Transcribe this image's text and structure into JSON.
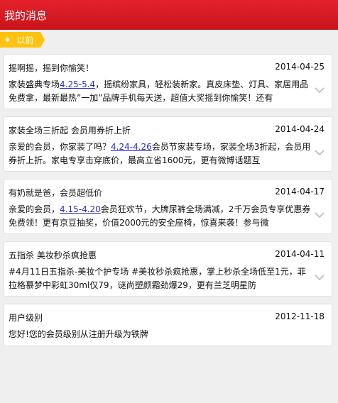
{
  "header": {
    "title": "我的消息"
  },
  "section": {
    "label": "以前",
    "icon": "sun-icon"
  },
  "messages": [
    {
      "title": "摇啊摇，摇到你愉笑！",
      "date": "2014-04-25",
      "body_pre": "家装盛典专场",
      "link": "4.25-5.4",
      "body_post": "，摇缤纷家具，轻松装新家。真皮床垫、灯具、家居用品免费拿，最新最热”一加”品牌手机每天送，超值大奖摇到你愉笑！还有"
    },
    {
      "title": "家装全场三折起 会员用券折上折",
      "date": "2014-04-24",
      "body_pre": "亲爱的会员，你家装了吗？",
      "link": "4.24-4.26",
      "body_post": "会员节家装专场，家装全场3折起，会员用券折上折。家电专享击穿底价，最高立省1600元，更有微博话题互"
    },
    {
      "title": "有奶就是爸，会员超低价",
      "date": "2014-04-17",
      "body_pre": "亲爱的会员，",
      "link": "4.15-4.20",
      "body_post": "会员狂欢节，大牌尿裤全场满减，2千万会员专享优惠券免费领！更有京豆抽奖，价值2000元的安全座椅，惊喜来袭！参与微"
    },
    {
      "title": "五指杀 美妆秒杀疯抢惠",
      "date": "2014-04-11",
      "body_pre": "#4月11日五指杀-美妆个护专场 #美妆秒杀疯抢惠，掌上秒杀全场低至1元，菲拉格慕梦中彩虹30ml仅79，谜尚塑颜霜劲爆29，更有兰芝明星防",
      "link": "",
      "body_post": ""
    },
    {
      "title": "用户级别",
      "date": "2012-11-18",
      "body_pre": "您好!您的会员级别从注册升级为铁牌",
      "link": "",
      "body_post": ""
    }
  ]
}
